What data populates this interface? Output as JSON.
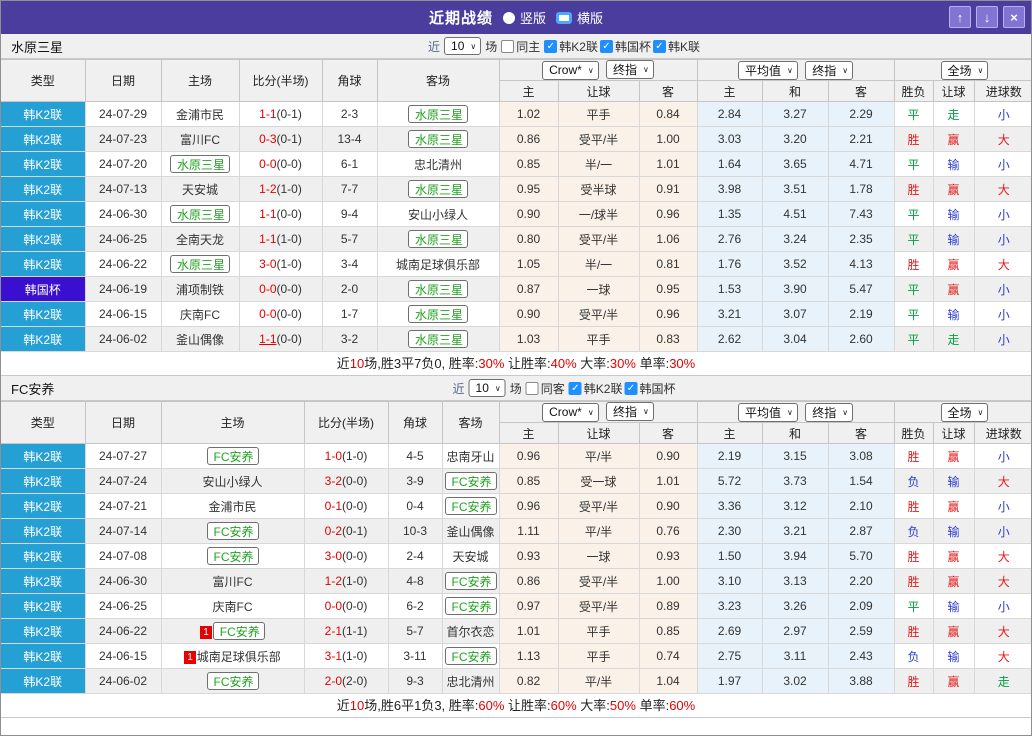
{
  "titlebar": {
    "title": "近期战绩",
    "radios": [
      {
        "label": "竖版",
        "selected": false
      },
      {
        "label": "横版",
        "selected": true
      }
    ],
    "buttons": {
      "up": "↑",
      "down": "↓",
      "close": "×"
    }
  },
  "columns": {
    "type": "类型",
    "date": "日期",
    "home": "主场",
    "score": "比分(半场)",
    "corner": "角球",
    "away": "客场",
    "crow_select": "Crow*",
    "crow_final": "终指",
    "crow_sub": [
      "主",
      "让球",
      "客"
    ],
    "avg_select": "平均值",
    "avg_final": "终指",
    "avg_sub": [
      "主",
      "和",
      "客"
    ],
    "scope_select": "全场",
    "result_sub": [
      "胜负",
      "让球",
      "进球数"
    ]
  },
  "result_colors": {
    "胜": "#e61919",
    "负": "#2b3bd0",
    "平": "#00a040",
    "赢": "#e61919",
    "输": "#2b3bd0",
    "走": "#00a040",
    "大": "#e61919",
    "小": "#2b3bd0"
  },
  "badge_colors": {
    "k2_league": "#25a0d5",
    "korea_cup": "#3a0fd0"
  },
  "sections": [
    {
      "team": "水原三星",
      "controls": {
        "near": "近",
        "count": "10",
        "games": "场",
        "same": "同主",
        "same_checked": false,
        "leagues": [
          "韩K2联",
          "韩国杯",
          "韩K联"
        ]
      },
      "rows": [
        {
          "lg": "韩K2联",
          "cup": false,
          "date": "24-07-29",
          "home": "金浦市民",
          "hsel": false,
          "score": "1-1",
          "half": "(0-1)",
          "corner": "2-3",
          "away": "水原三星",
          "asel": true,
          "crow": [
            "1.02",
            "平手",
            "0.84"
          ],
          "avg": [
            "2.84",
            "3.27",
            "2.29"
          ],
          "res": [
            "平",
            "走",
            "小"
          ]
        },
        {
          "lg": "韩K2联",
          "cup": false,
          "date": "24-07-23",
          "home": "富川FC",
          "hsel": false,
          "score": "0-3",
          "half": "(0-1)",
          "corner": "13-4",
          "away": "水原三星",
          "asel": true,
          "crow": [
            "0.86",
            "受平/半",
            "1.00"
          ],
          "avg": [
            "3.03",
            "3.20",
            "2.21"
          ],
          "res": [
            "胜",
            "赢",
            "大"
          ]
        },
        {
          "lg": "韩K2联",
          "cup": false,
          "date": "24-07-20",
          "home": "水原三星",
          "hsel": true,
          "score": "0-0",
          "half": "(0-0)",
          "corner": "6-1",
          "away": "忠北清州",
          "asel": false,
          "crow": [
            "0.85",
            "半/一",
            "1.01"
          ],
          "avg": [
            "1.64",
            "3.65",
            "4.71"
          ],
          "res": [
            "平",
            "输",
            "小"
          ]
        },
        {
          "lg": "韩K2联",
          "cup": false,
          "date": "24-07-13",
          "home": "天安城",
          "hsel": false,
          "score": "1-2",
          "half": "(1-0)",
          "corner": "7-7",
          "away": "水原三星",
          "asel": true,
          "crow": [
            "0.95",
            "受半球",
            "0.91"
          ],
          "avg": [
            "3.98",
            "3.51",
            "1.78"
          ],
          "res": [
            "胜",
            "赢",
            "大"
          ]
        },
        {
          "lg": "韩K2联",
          "cup": false,
          "date": "24-06-30",
          "home": "水原三星",
          "hsel": true,
          "score": "1-1",
          "half": "(0-0)",
          "corner": "9-4",
          "away": "安山小绿人",
          "asel": false,
          "crow": [
            "0.90",
            "一/球半",
            "0.96"
          ],
          "avg": [
            "1.35",
            "4.51",
            "7.43"
          ],
          "res": [
            "平",
            "输",
            "小"
          ]
        },
        {
          "lg": "韩K2联",
          "cup": false,
          "date": "24-06-25",
          "home": "全南天龙",
          "hsel": false,
          "score": "1-1",
          "half": "(1-0)",
          "corner": "5-7",
          "away": "水原三星",
          "asel": true,
          "crow": [
            "0.80",
            "受平/半",
            "1.06"
          ],
          "avg": [
            "2.76",
            "3.24",
            "2.35"
          ],
          "res": [
            "平",
            "输",
            "小"
          ]
        },
        {
          "lg": "韩K2联",
          "cup": false,
          "date": "24-06-22",
          "home": "水原三星",
          "hsel": true,
          "score": "3-0",
          "half": "(1-0)",
          "corner": "3-4",
          "away": "城南足球俱乐部",
          "asel": false,
          "crow": [
            "1.05",
            "半/一",
            "0.81"
          ],
          "avg": [
            "1.76",
            "3.52",
            "4.13"
          ],
          "res": [
            "胜",
            "赢",
            "大"
          ]
        },
        {
          "lg": "韩国杯",
          "cup": true,
          "date": "24-06-19",
          "home": "浦项制铁",
          "hsel": false,
          "score": "0-0",
          "half": "(0-0)",
          "corner": "2-0",
          "away": "水原三星",
          "asel": true,
          "crow": [
            "0.87",
            "一球",
            "0.95"
          ],
          "avg": [
            "1.53",
            "3.90",
            "5.47"
          ],
          "res": [
            "平",
            "赢",
            "小"
          ]
        },
        {
          "lg": "韩K2联",
          "cup": false,
          "date": "24-06-15",
          "home": "庆南FC",
          "hsel": false,
          "score": "0-0",
          "half": "(0-0)",
          "corner": "1-7",
          "away": "水原三星",
          "asel": true,
          "crow": [
            "0.90",
            "受平/半",
            "0.96"
          ],
          "avg": [
            "3.21",
            "3.07",
            "2.19"
          ],
          "res": [
            "平",
            "输",
            "小"
          ]
        },
        {
          "lg": "韩K2联",
          "cup": false,
          "date": "24-06-02",
          "home": "釜山偶像",
          "hsel": false,
          "score": "1-1",
          "half": "(0-0)",
          "uline": true,
          "corner": "3-2",
          "away": "水原三星",
          "asel": true,
          "crow": [
            "1.03",
            "平手",
            "0.83"
          ],
          "avg": [
            "2.62",
            "3.04",
            "2.60"
          ],
          "res": [
            "平",
            "走",
            "小"
          ]
        }
      ],
      "summary": [
        {
          "t": "近"
        },
        {
          "t": "10",
          "red": true
        },
        {
          "t": "场,胜3平7负0, 胜率:"
        },
        {
          "t": "30%",
          "red": true
        },
        {
          "t": " 让胜率:"
        },
        {
          "t": "40%",
          "red": true
        },
        {
          "t": " 大率:"
        },
        {
          "t": "30%",
          "red": true
        },
        {
          "t": " 单率:"
        },
        {
          "t": "30%",
          "red": true
        }
      ]
    },
    {
      "team": "FC安养",
      "controls": {
        "near": "近",
        "count": "10",
        "games": "场",
        "same": "同客",
        "same_checked": false,
        "leagues": [
          "韩K2联",
          "韩国杯"
        ]
      },
      "rows": [
        {
          "lg": "韩K2联",
          "cup": false,
          "date": "24-07-27",
          "home": "FC安养",
          "hsel": true,
          "score": "1-0",
          "half": "(1-0)",
          "corner": "4-5",
          "away": "忠南牙山",
          "asel": false,
          "crow": [
            "0.96",
            "平/半",
            "0.90"
          ],
          "avg": [
            "2.19",
            "3.15",
            "3.08"
          ],
          "res": [
            "胜",
            "赢",
            "小"
          ]
        },
        {
          "lg": "韩K2联",
          "cup": false,
          "date": "24-07-24",
          "home": "安山小绿人",
          "hsel": false,
          "score": "3-2",
          "half": "(0-0)",
          "corner": "3-9",
          "away": "FC安养",
          "asel": true,
          "crow": [
            "0.85",
            "受一球",
            "1.01"
          ],
          "avg": [
            "5.72",
            "3.73",
            "1.54"
          ],
          "res": [
            "负",
            "输",
            "大"
          ]
        },
        {
          "lg": "韩K2联",
          "cup": false,
          "date": "24-07-21",
          "home": "金浦市民",
          "hsel": false,
          "score": "0-1",
          "half": "(0-0)",
          "corner": "0-4",
          "away": "FC安养",
          "asel": true,
          "crow": [
            "0.96",
            "受平/半",
            "0.90"
          ],
          "avg": [
            "3.36",
            "3.12",
            "2.10"
          ],
          "res": [
            "胜",
            "赢",
            "小"
          ]
        },
        {
          "lg": "韩K2联",
          "cup": false,
          "date": "24-07-14",
          "home": "FC安养",
          "hsel": true,
          "score": "0-2",
          "half": "(0-1)",
          "corner": "10-3",
          "away": "釜山偶像",
          "asel": false,
          "crow": [
            "1.11",
            "平/半",
            "0.76"
          ],
          "avg": [
            "2.30",
            "3.21",
            "2.87"
          ],
          "res": [
            "负",
            "输",
            "小"
          ]
        },
        {
          "lg": "韩K2联",
          "cup": false,
          "date": "24-07-08",
          "home": "FC安养",
          "hsel": true,
          "score": "3-0",
          "half": "(0-0)",
          "corner": "2-4",
          "away": "天安城",
          "asel": false,
          "crow": [
            "0.93",
            "一球",
            "0.93"
          ],
          "avg": [
            "1.50",
            "3.94",
            "5.70"
          ],
          "res": [
            "胜",
            "赢",
            "大"
          ]
        },
        {
          "lg": "韩K2联",
          "cup": false,
          "date": "24-06-30",
          "home": "富川FC",
          "hsel": false,
          "score": "1-2",
          "half": "(1-0)",
          "corner": "4-8",
          "away": "FC安养",
          "asel": true,
          "crow": [
            "0.86",
            "受平/半",
            "1.00"
          ],
          "avg": [
            "3.10",
            "3.13",
            "2.20"
          ],
          "res": [
            "胜",
            "赢",
            "大"
          ]
        },
        {
          "lg": "韩K2联",
          "cup": false,
          "date": "24-06-25",
          "home": "庆南FC",
          "hsel": false,
          "score": "0-0",
          "half": "(0-0)",
          "corner": "6-2",
          "away": "FC安养",
          "asel": true,
          "crow": [
            "0.97",
            "受平/半",
            "0.89"
          ],
          "avg": [
            "3.23",
            "3.26",
            "2.09"
          ],
          "res": [
            "平",
            "输",
            "小"
          ]
        },
        {
          "lg": "韩K2联",
          "cup": false,
          "date": "24-06-22",
          "home": "FC安养",
          "hsel": true,
          "hcard": "1",
          "score": "2-1",
          "half": "(1-1)",
          "corner": "5-7",
          "away": "首尔衣恋",
          "asel": false,
          "crow": [
            "1.01",
            "平手",
            "0.85"
          ],
          "avg": [
            "2.69",
            "2.97",
            "2.59"
          ],
          "res": [
            "胜",
            "赢",
            "大"
          ]
        },
        {
          "lg": "韩K2联",
          "cup": false,
          "date": "24-06-15",
          "home": "城南足球俱乐部",
          "hsel": false,
          "hcard": "1",
          "score": "3-1",
          "half": "(1-0)",
          "corner": "3-11",
          "away": "FC安养",
          "asel": true,
          "crow": [
            "1.13",
            "平手",
            "0.74"
          ],
          "avg": [
            "2.75",
            "3.11",
            "2.43"
          ],
          "res": [
            "负",
            "输",
            "大"
          ]
        },
        {
          "lg": "韩K2联",
          "cup": false,
          "date": "24-06-02",
          "home": "FC安养",
          "hsel": true,
          "score": "2-0",
          "half": "(2-0)",
          "corner": "9-3",
          "away": "忠北清州",
          "asel": false,
          "crow": [
            "0.82",
            "平/半",
            "1.04"
          ],
          "avg": [
            "1.97",
            "3.02",
            "3.88"
          ],
          "res": [
            "胜",
            "赢",
            "走"
          ]
        }
      ],
      "summary": [
        {
          "t": "近"
        },
        {
          "t": "10",
          "red": true
        },
        {
          "t": "场,胜6平1负3, 胜率:"
        },
        {
          "t": "60%",
          "red": true
        },
        {
          "t": " 让胜率:"
        },
        {
          "t": "60%",
          "red": true
        },
        {
          "t": " 大率:"
        },
        {
          "t": "50%",
          "red": true
        },
        {
          "t": " 单率:"
        },
        {
          "t": "60%",
          "red": true
        }
      ]
    }
  ]
}
